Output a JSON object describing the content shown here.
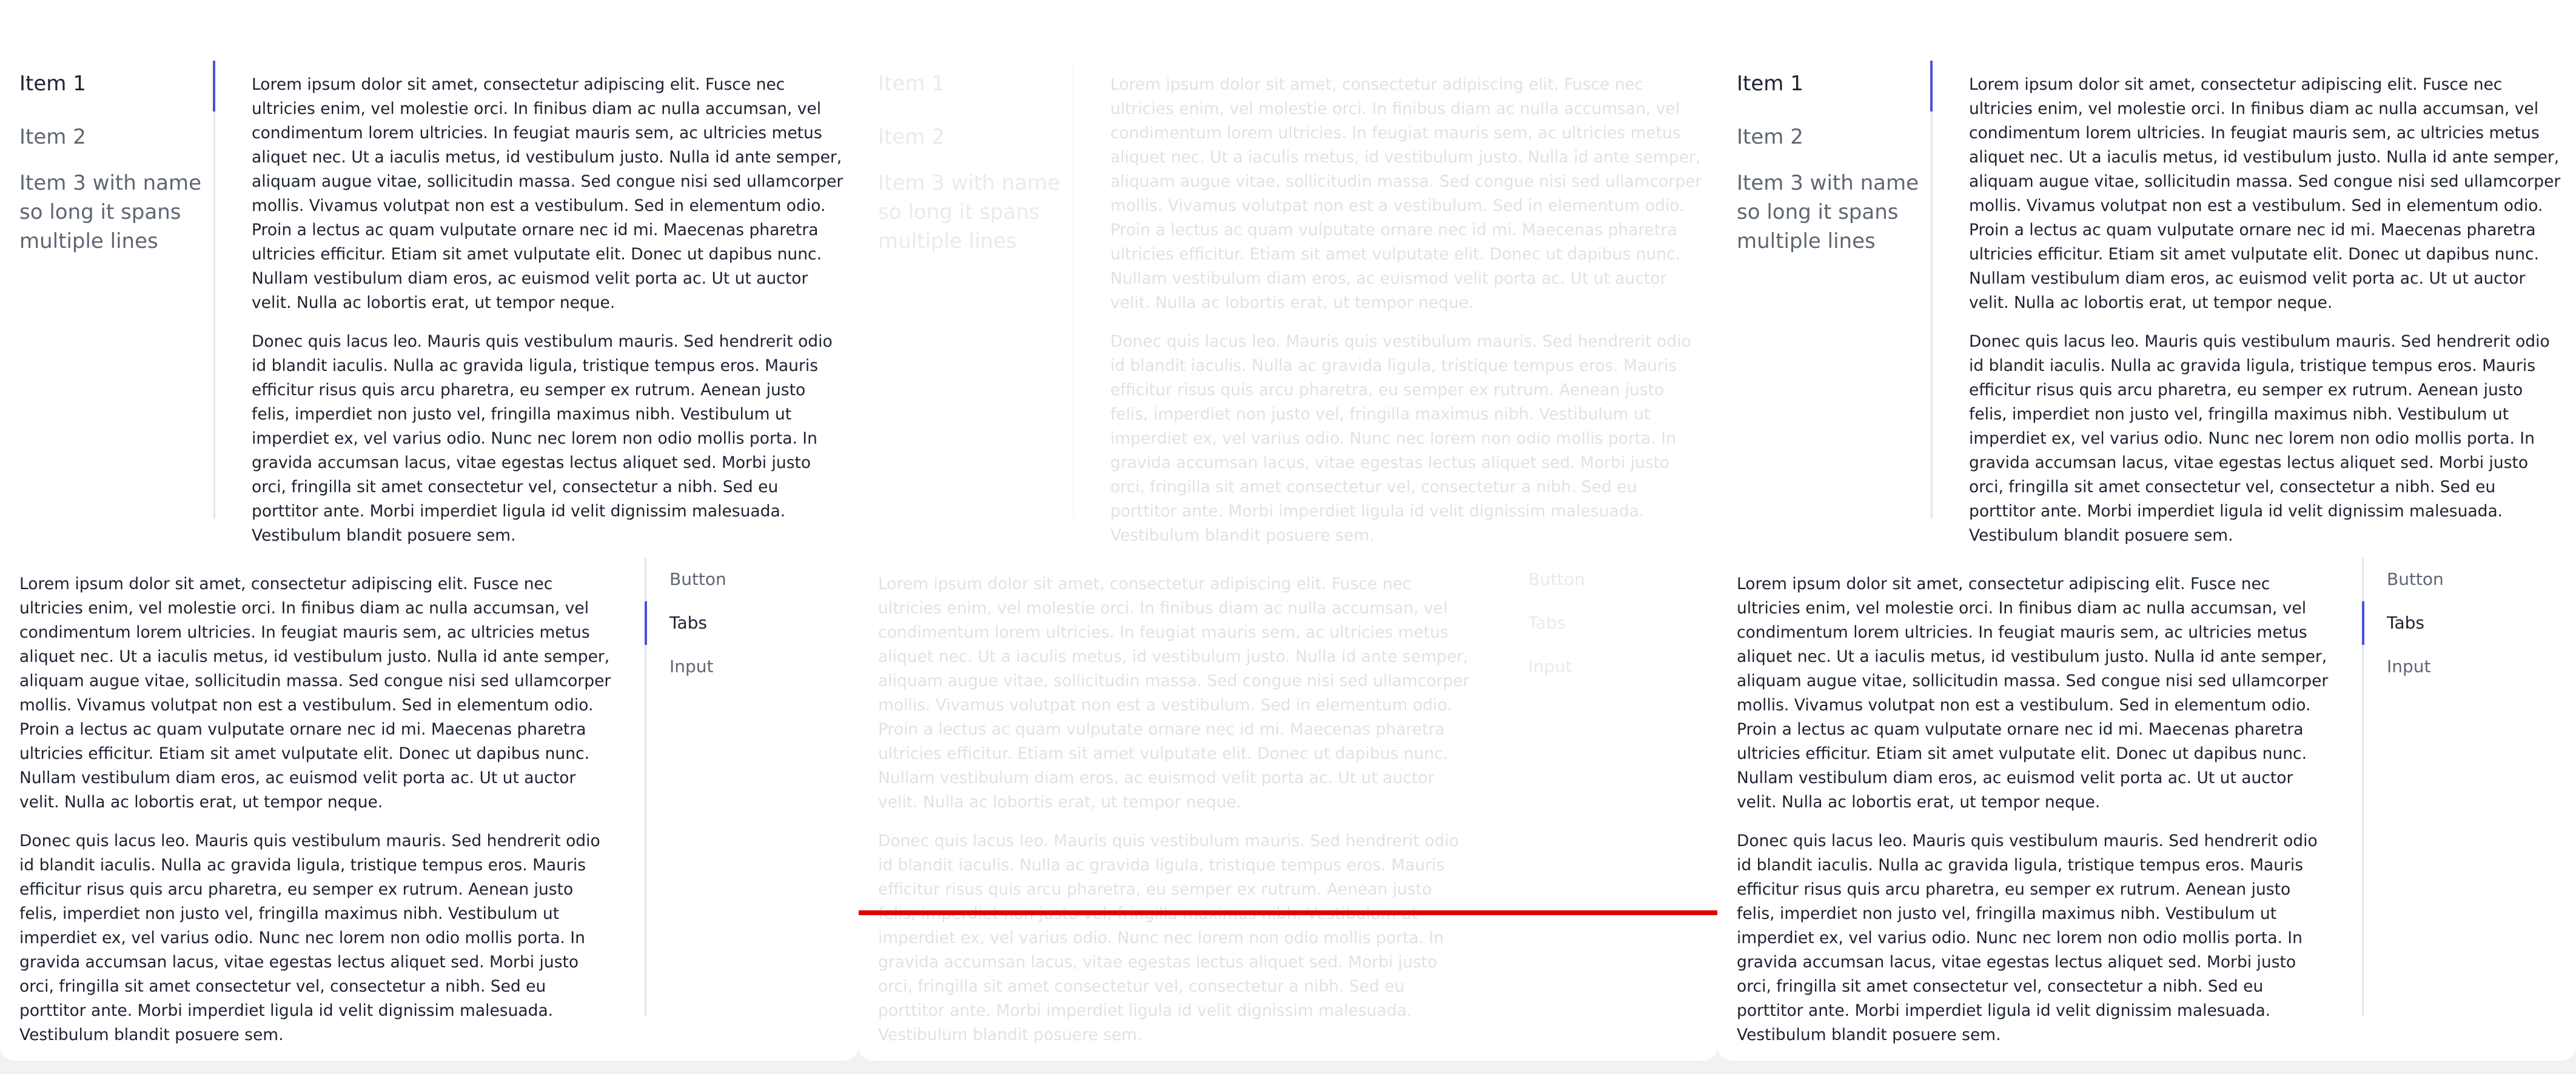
{
  "colors": {
    "accent": "#4655d4",
    "divider": "#e4e6ea",
    "text": "#1c2230",
    "muted_text": "#5f6672",
    "highlight_line": "#e00000"
  },
  "left_tabs": {
    "items": [
      {
        "label": "Item 1"
      },
      {
        "label": "Item 2"
      },
      {
        "label": "Item 3 with name so long it spans multiple lines"
      }
    ],
    "active_index": 0
  },
  "right_tabs": {
    "items": [
      {
        "label": "Button"
      },
      {
        "label": "Tabs"
      },
      {
        "label": "Input"
      }
    ],
    "active_index": 1
  },
  "content": {
    "paragraph_1": "Lorem ipsum dolor sit amet, consectetur adipiscing elit. Fusce nec ultricies enim, vel molestie orci. In finibus diam ac nulla accumsan, vel condimentum lorem ultricies. In feugiat mauris sem, ac ultricies metus aliquet nec. Ut a iaculis metus, id vestibulum justo. Nulla id ante semper, aliquam augue vitae, sollicitudin massa. Sed congue nisi sed ullamcorper mollis. Vivamus volutpat non est a vestibulum. Sed in elementum odio. Proin a lectus ac quam vulputate ornare nec id mi. Maecenas pharetra ultricies efficitur. Etiam sit amet vulputate elit. Donec ut dapibus nunc. Nullam vestibulum diam eros, ac euismod velit porta ac. Ut ut auctor velit. Nulla ac lobortis erat, ut tempor neque.",
    "paragraph_2": "Donec quis lacus leo. Mauris quis vestibulum mauris. Sed hendrerit odio id blandit iaculis. Nulla ac gravida ligula, tristique tempus eros. Mauris efficitur risus quis arcu pharetra, eu semper ex rutrum. Aenean justo felis, imperdiet non justo vel, fringilla maximus nibh. Vestibulum ut imperdiet ex, vel varius odio. Nunc nec lorem non odio mollis porta. In gravida accumsan lacus, vitae egestas lectus aliquet sed. Morbi justo orci, fringilla sit amet consectetur vel, consectetur a nibh. Sed eu porttitor ante. Morbi imperdiet ligula id velit dignissim malesuada. Vestibulum blandit posuere sem."
  }
}
